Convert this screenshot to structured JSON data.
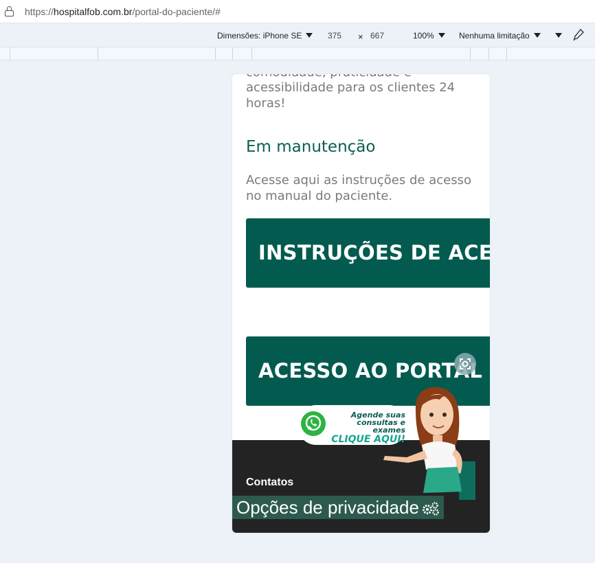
{
  "browser": {
    "url_scheme": "https://",
    "url_host": "hospitalfob.com.br",
    "url_path": "/portal-do-paciente/#"
  },
  "device_toolbar": {
    "dimensions_label": "Dimensões: iPhone SE",
    "width": "375",
    "times": "×",
    "height": "667",
    "zoom": "100%",
    "throttle": "Nenhuma limitação"
  },
  "page": {
    "cut_line": "comodidade, praticidade e",
    "intro_text": "acessibilidade para os clientes 24 horas!",
    "heading": "Em manutenção",
    "body_text": "Acesse aqui as instruções de acesso no manual do paciente.",
    "button_instructions": "INSTRUÇÕES DE ACESSO",
    "button_portal": "ACESSO AO PORTAL DO PACIENTE"
  },
  "whatsapp_widget": {
    "line1": "Agende suas",
    "line2": "consultas e exames",
    "line3": "CLIQUE AQUI!"
  },
  "footer": {
    "contacts_title": "Contatos",
    "privacy_label": "Opções de privacidade"
  },
  "colors": {
    "brand_green": "#035b4f",
    "heading_green": "#0c5e52",
    "whatsapp_green": "#2db342",
    "footer_bg": "#232323"
  }
}
